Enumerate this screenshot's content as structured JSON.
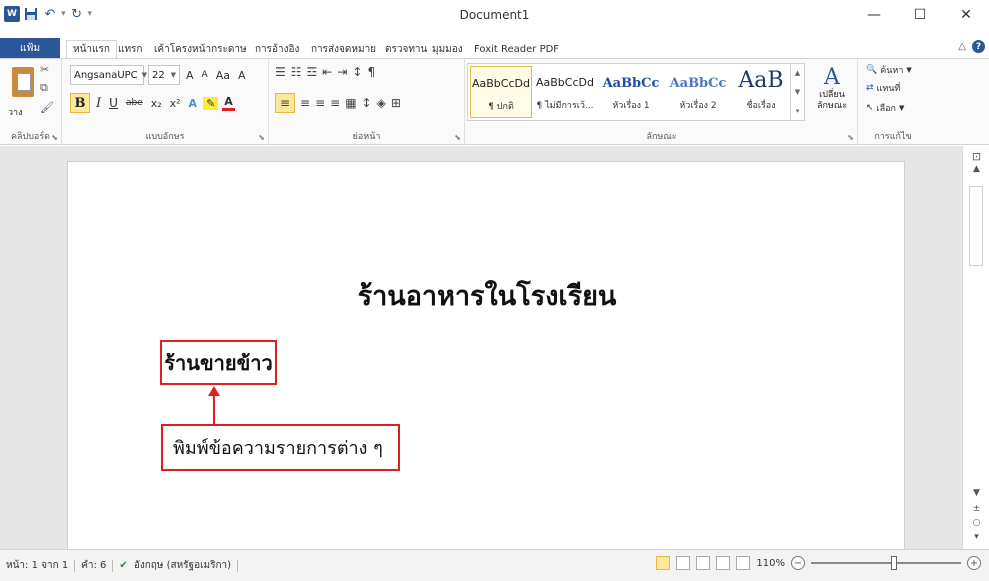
{
  "window": {
    "title": "Document1",
    "minimize": "—",
    "maximize": "☐",
    "close": "✕"
  },
  "qat": {
    "word_logo": "W",
    "save": "💾",
    "undo": "↶",
    "redo": "↻",
    "customize": "▾"
  },
  "tabs": {
    "file": "แฟ้ม",
    "items": [
      "หน้าแรก",
      "แทรก",
      "เค้าโครงหน้ากระดาษ",
      "การอ้างอิง",
      "การส่งจดหมาย",
      "ตรวจทาน",
      "มุมมอง",
      "Foxit Reader PDF"
    ],
    "collapse": "△",
    "help": "?"
  },
  "ribbon": {
    "clipboard": {
      "label": "คลิปบอร์ด",
      "paste": "วาง"
    },
    "font": {
      "label": "แบบอักษร",
      "font_name": "AngsanaUPC",
      "font_size": "22",
      "grow": "A",
      "shrink": "A",
      "change_case": "Aa",
      "clear": "A",
      "bold": "B",
      "italic": "I",
      "underline": "U",
      "strike": "abe",
      "subscript": "x₂",
      "superscript": "x²"
    },
    "paragraph": {
      "label": "ย่อหน้า",
      "show_marks": "¶",
      "sort": "↕"
    },
    "styles": {
      "label": "ลักษณะ",
      "items": [
        {
          "preview": "AaBbCcDd",
          "name": "¶ ปกติ"
        },
        {
          "preview": "AaBbCcDd",
          "name": "¶ ไม่มีการเว้..."
        },
        {
          "preview": "AaBbCc",
          "name": "หัวเรื่อง 1"
        },
        {
          "preview": "AaBbCc",
          "name": "หัวเรื่อง 2"
        },
        {
          "preview": "AaB",
          "name": "ชื่อเรื่อง"
        }
      ]
    },
    "change_styles": {
      "label": "เปลี่ยน ลักษณะ",
      "icon_text": "A"
    },
    "editing": {
      "label": "การแก้ไข",
      "find": "ค้นหา",
      "replace": "แทนที่",
      "select": "เลือก"
    }
  },
  "document": {
    "title": "ร้านอาหารในโรงเรียน",
    "heading": "ร้านขายข้าว",
    "callout": "พิมพ์ข้อความรายการต่าง ๆ"
  },
  "status": {
    "page": "หน้า: 1 จาก 1",
    "words": "คำ: 6",
    "language": "อังกฤษ (สหรัฐอเมริกา)",
    "zoom": "110%",
    "zoom_out": "−",
    "zoom_in": "+"
  },
  "colors": {
    "accent": "#2b579a",
    "highlight": "#fde79a",
    "callout": "#e02020"
  }
}
